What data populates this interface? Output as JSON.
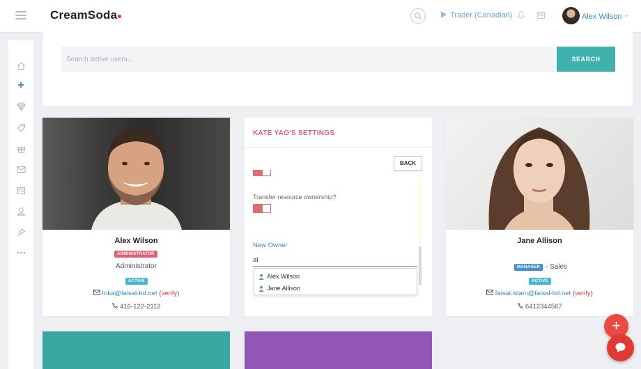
{
  "app": {
    "logo": "CreamSoda",
    "accent": "#3fb2ad",
    "brand_dot": "#e03131"
  },
  "header": {
    "context_label": "Trader (Canadian)",
    "user_name": "Alex Wilson",
    "icons": [
      "menu-icon",
      "search-icon",
      "play-icon",
      "bell-icon",
      "calendar-icon",
      "chevron-down-icon"
    ]
  },
  "sidebar": {
    "items": [
      {
        "icon": "home-icon"
      },
      {
        "icon": "plus-icon",
        "active": true
      },
      {
        "icon": "diamond-icon"
      },
      {
        "icon": "tag-icon"
      },
      {
        "icon": "gift-icon"
      },
      {
        "icon": "mail-icon"
      },
      {
        "icon": "calendar-icon"
      },
      {
        "icon": "user-icon"
      },
      {
        "icon": "pin-icon"
      },
      {
        "icon": "more-icon"
      }
    ]
  },
  "search": {
    "placeholder": "Search active users...",
    "button_label": "SEARCH"
  },
  "cards": {
    "alex": {
      "name": "Alex Wilson",
      "role_badge": "ADMINISTRATOR",
      "role_text": "Administrator",
      "status": "ACTIVE",
      "email": "Inka@faisal-bd.net",
      "verify": "verify",
      "phone": "416-122-2112"
    },
    "jane": {
      "name": "Jane Allison",
      "role_badge": "MANAGER",
      "role_text": "- Sales",
      "status": "ACTIVE",
      "email": "faisal.islam@faisal-bd.net",
      "verify": "verify",
      "phone": "6412344567"
    }
  },
  "settings": {
    "title": "KATE YAO'S SETTINGS",
    "back_label": "BACK",
    "transfer_label": "Transfer resource ownership?",
    "transfer_enabled": true,
    "new_owner_label": "New Owner",
    "new_owner_value": "al",
    "suggestions": [
      "Alex Wilson",
      "Jane Allison"
    ]
  },
  "colors": {
    "teal_card": "#3aa6a0",
    "purple_card": "#9156b6",
    "fab": "#e94b43",
    "badge_red": "#e0606d",
    "badge_blue": "#4a8fd0",
    "badge_active": "#44b8d0"
  }
}
